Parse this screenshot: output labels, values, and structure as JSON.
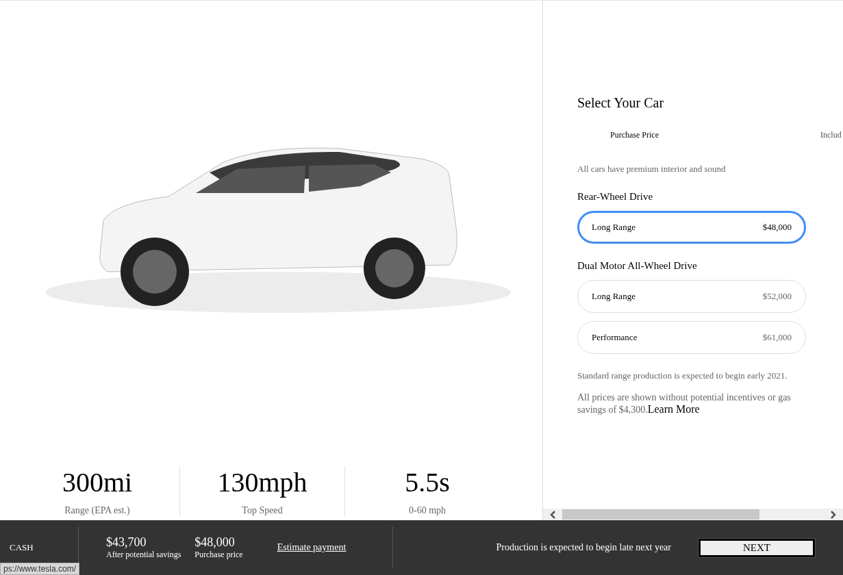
{
  "stats": [
    {
      "value": "300mi",
      "label": "Range (EPA est.)"
    },
    {
      "value": "130mph",
      "label": "Top Speed"
    },
    {
      "value": "5.5s",
      "label": "0-60 mph"
    }
  ],
  "panel": {
    "title": "Select Your Car",
    "price_views": [
      "Purchase Price",
      "Includ"
    ],
    "note": "All cars have premium interior and sound",
    "groups": [
      {
        "name": "Rear-Wheel Drive",
        "options": [
          {
            "name": "Long Range",
            "price": "$48,000",
            "selected": true
          }
        ]
      },
      {
        "name": "Dual Motor All-Wheel Drive",
        "options": [
          {
            "name": "Long Range",
            "price": "$52,000",
            "selected": false
          },
          {
            "name": "Performance",
            "price": "$61,000",
            "selected": false
          }
        ]
      }
    ],
    "footnote": "Standard range production is expected to begin early 2021.",
    "disclaimer": "All prices are shown without potential incentives or gas savings of $4,300.",
    "disclaimer_link": "Learn More"
  },
  "bottom_bar": {
    "payment_type": "CASH",
    "prices": [
      {
        "amount": "$43,700",
        "label": "After potential savings"
      },
      {
        "amount": "$48,000",
        "label": "Purchase price"
      }
    ],
    "estimate_link": "Estimate payment",
    "production_note": "Production is expected to begin late next year",
    "next_button": "NEXT"
  },
  "status_url": "ps://www.tesla.com/"
}
